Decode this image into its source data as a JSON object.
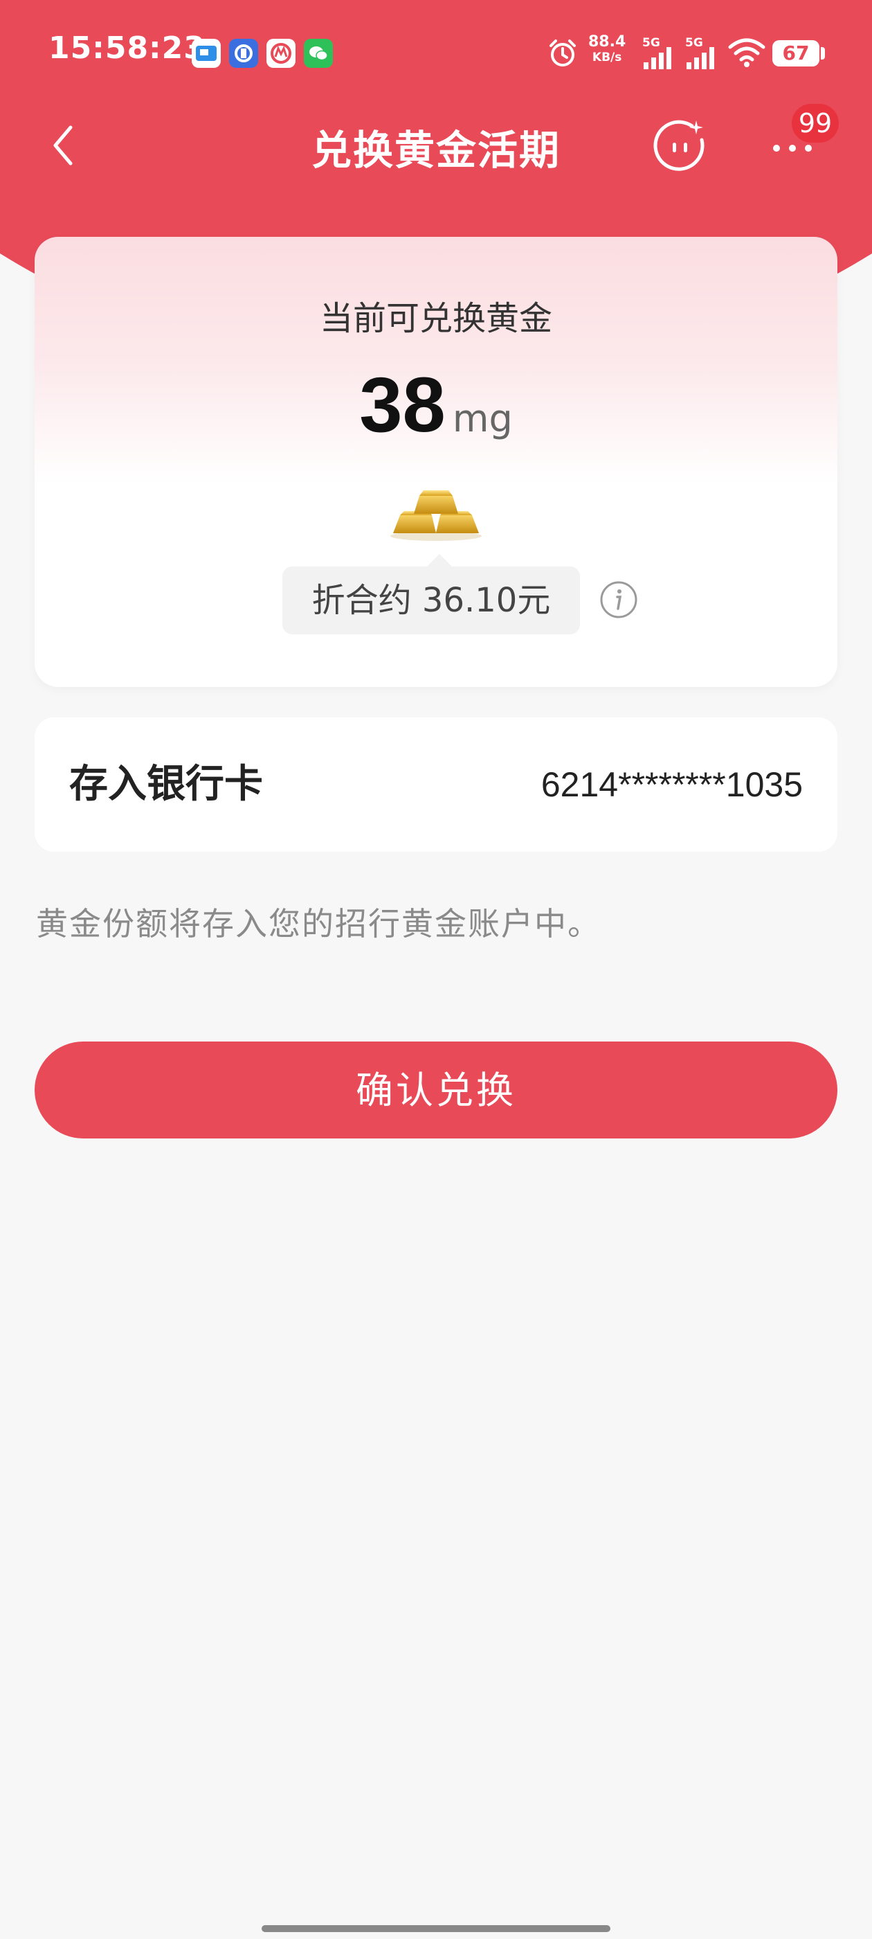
{
  "status_bar": {
    "time": "15:58:23",
    "net_speed": "88.4",
    "net_speed_unit": "KB/s",
    "signal1_label": "5G",
    "signal2_label": "5G",
    "battery": "67",
    "app_icons": [
      "map-app-icon",
      "baidu-netdisk-icon",
      "cmb-app-icon",
      "wechat-icon"
    ]
  },
  "nav": {
    "title": "兑换黄金活期",
    "badge_count": "99"
  },
  "gold_card": {
    "label": "当前可兑换黄金",
    "amount": "38",
    "unit": "mg",
    "approx_text": "折合约 36.10元"
  },
  "bank": {
    "label": "存入银行卡",
    "card_number": "6214********1035"
  },
  "hint": "黄金份额将存入您的招行黄金账户中。",
  "confirm_button": "确认兑换",
  "colors": {
    "primary_red": "#e84a58",
    "badge_red": "#e8333f",
    "background": "#f7f7f7"
  }
}
